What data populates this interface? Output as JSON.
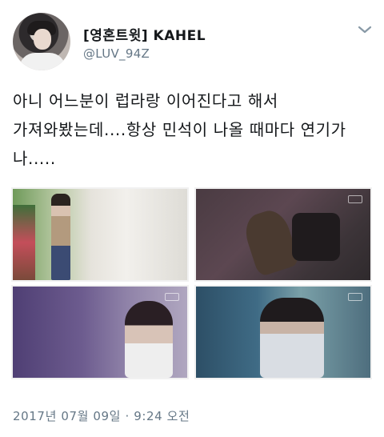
{
  "tweet": {
    "display_name": "[영혼트윗] KAHEL",
    "handle": "@LUV_94Z",
    "text_lines": [
      "아니 어느분이 럽라랑 이어진다고 해서",
      "가져와봤는데....항상 민석이 나올 때마다 연기가",
      "나....."
    ],
    "timestamp": "2017년 07월 09일 · 9:24 오전"
  },
  "icons": {
    "menu": "chevron-down-icon"
  },
  "colors": {
    "text": "#14171a",
    "muted": "#657786",
    "background": "#ffffff"
  }
}
